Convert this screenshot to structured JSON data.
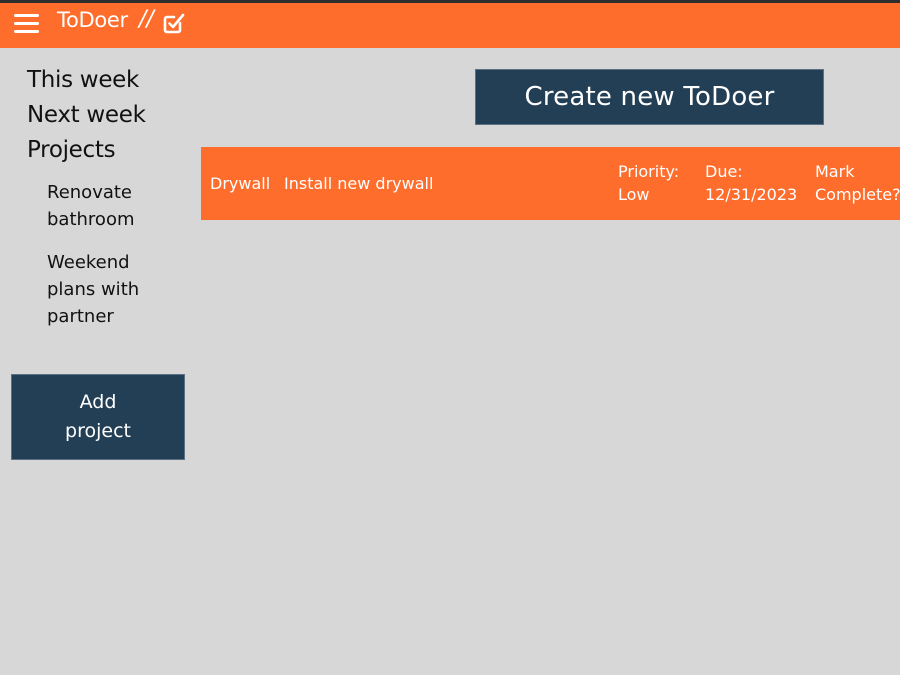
{
  "header": {
    "title": "ToDoer",
    "separator": "//",
    "menu_icon": "hamburger-menu-icon",
    "logo_icon": "checkbox-edit-icon"
  },
  "sidebar": {
    "nav": [
      {
        "label": "This week"
      },
      {
        "label": "Next week"
      },
      {
        "label": "Projects"
      }
    ],
    "projects": [
      {
        "label": "Renovate bathroom"
      },
      {
        "label": "Weekend plans with partner"
      }
    ],
    "add_project_label": "Add project"
  },
  "main": {
    "create_button_label": "Create new ToDoer",
    "todos": [
      {
        "title": "Drywall",
        "description": "Install new drywall",
        "priority_label": "Priority:",
        "priority_value": "Low",
        "due_label": "Due:",
        "due_value": "12/31/2023",
        "complete_line1": "Mark",
        "complete_line2": "Complete?"
      }
    ]
  },
  "colors": {
    "accent": "#fe6d2c",
    "dark": "#233f55",
    "background": "#d7d7d7"
  }
}
